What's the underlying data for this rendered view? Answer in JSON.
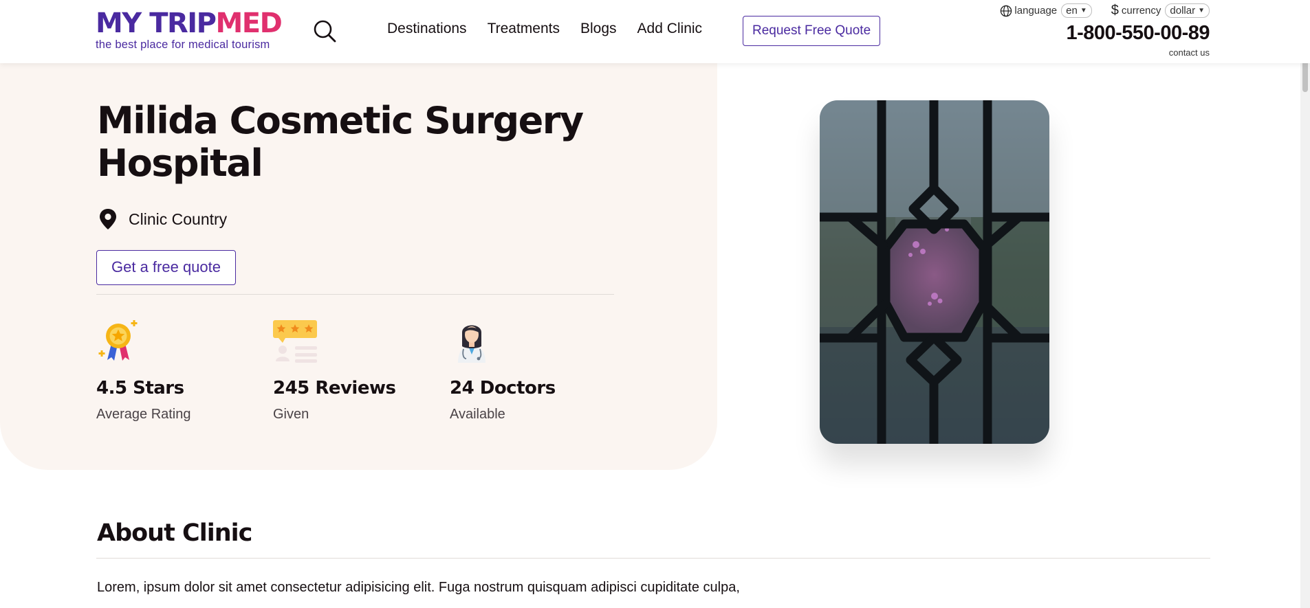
{
  "header": {
    "logo": {
      "part1": "MY TRIP",
      "part2": "MED",
      "tagline": "the best place for medical tourism"
    },
    "nav": [
      "Destinations",
      "Treatments",
      "Blogs",
      "Add Clinic"
    ],
    "quote_button": "Request Free Quote",
    "language": {
      "label": "language",
      "value": "en"
    },
    "currency": {
      "label": "currency",
      "value": "dollar"
    },
    "phone": "1-800-550-00-89",
    "contact": "contact us"
  },
  "hero": {
    "title": "Milida Cosmetic Surgery Hospital",
    "location": "Clinic Country",
    "cta": "Get a free quote",
    "stats": [
      {
        "icon": "award-medal-icon",
        "value": "4.5 Stars",
        "label": "Average Rating"
      },
      {
        "icon": "reviews-icon",
        "value": "245 Reviews",
        "label": "Given"
      },
      {
        "icon": "doctor-icon",
        "value": "24 Doctors",
        "label": "Available"
      }
    ]
  },
  "about": {
    "title": "About Clinic",
    "text": "Lorem, ipsum dolor sit amet consectetur adipisicing elit. Fuga nostrum quisquam adipisci cupiditate culpa,"
  },
  "colors": {
    "brand_purple": "#4a2aa0",
    "brand_pink": "#e0306e",
    "hero_bg": "#fbf5f1"
  }
}
